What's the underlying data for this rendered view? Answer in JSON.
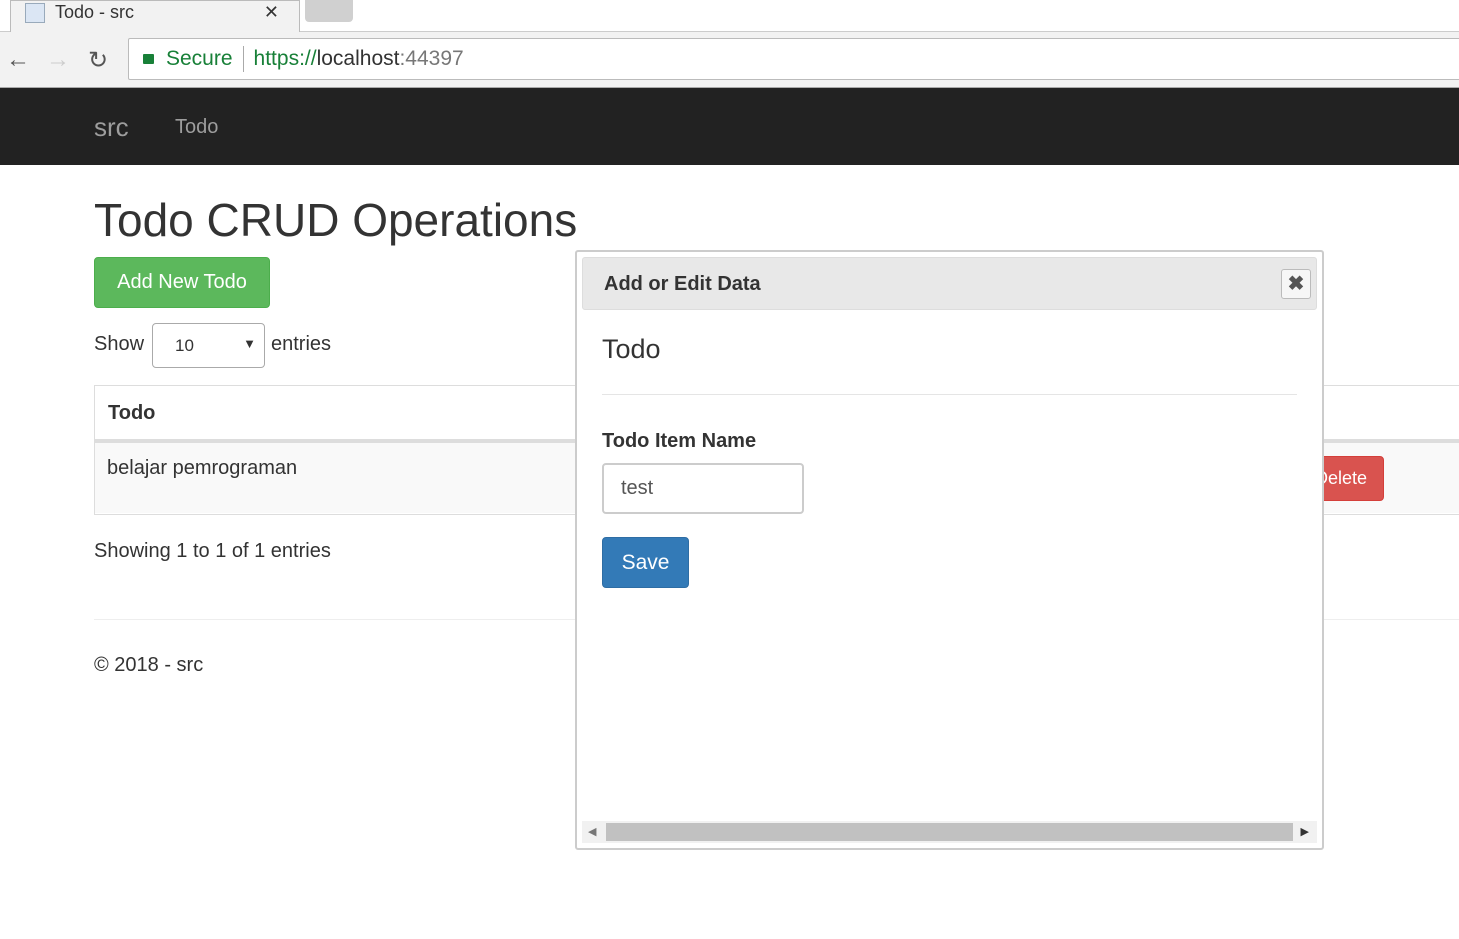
{
  "browser": {
    "tab_title": "Todo - src",
    "secure_label": "Secure",
    "url_scheme": "https://",
    "url_host": "localhost",
    "url_port": ":44397"
  },
  "navbar": {
    "brand": "src",
    "links": [
      "Todo"
    ]
  },
  "page": {
    "title": "Todo CRUD Operations",
    "add_button": "Add New Todo",
    "show_label": "Show",
    "page_size": "10",
    "entries_label": "entries",
    "table": {
      "columns": [
        "Todo"
      ],
      "rows": [
        {
          "todo": "belajar pemrograman",
          "delete_label": "Delete"
        }
      ]
    },
    "info": "Showing 1 to 1 of 1 entries",
    "footer": "© 2018 - src"
  },
  "dialog": {
    "title": "Add or Edit Data",
    "subtitle": "Todo",
    "field_label": "Todo Item Name",
    "field_value": "test",
    "save_label": "Save"
  }
}
